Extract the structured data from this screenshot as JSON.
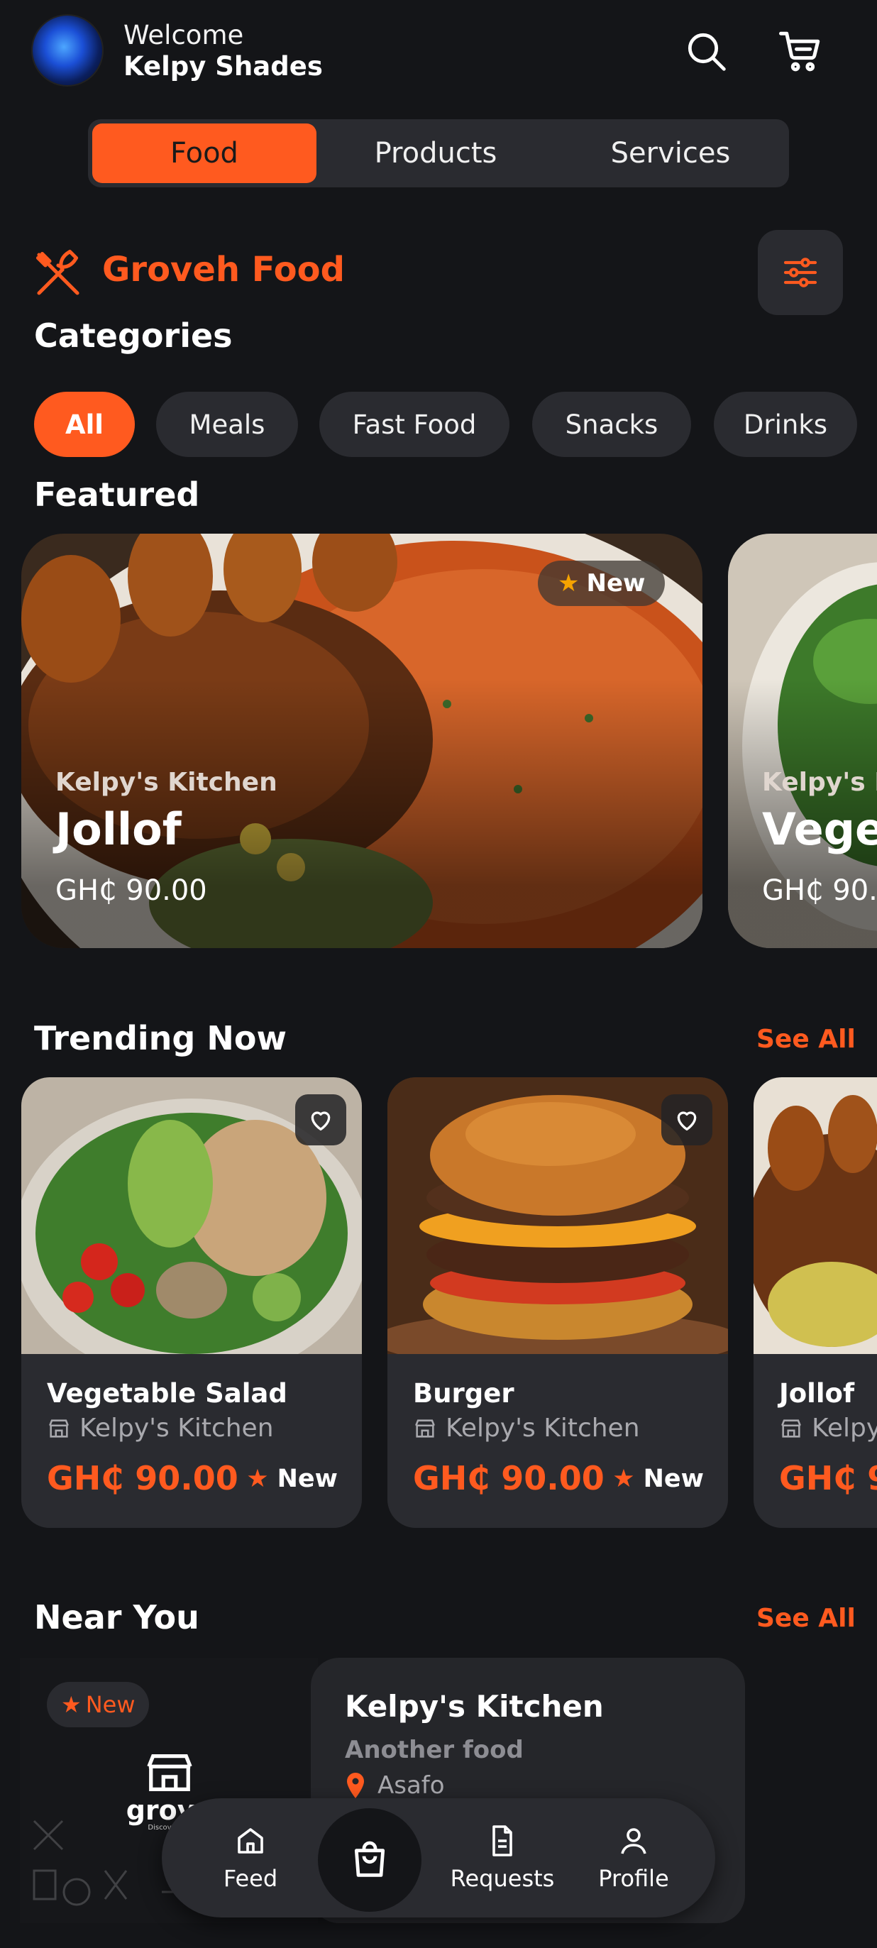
{
  "header": {
    "welcome": "Welcome",
    "username": "Kelpy Shades"
  },
  "tabs": [
    "Food",
    "Products",
    "Services"
  ],
  "brand": {
    "name": "Groveh Food"
  },
  "categories": {
    "title": "Categories",
    "items": [
      "All",
      "Meals",
      "Fast Food",
      "Snacks",
      "Drinks"
    ]
  },
  "featured": {
    "title": "Featured",
    "cards": [
      {
        "vendor": "Kelpy's Kitchen",
        "name": "Jollof",
        "price": "GH₵ 90.00",
        "badge": "New"
      },
      {
        "vendor": "Kelpy's K",
        "name": "Veget",
        "price": "GH₵ 90."
      }
    ]
  },
  "trending": {
    "title": "Trending Now",
    "see_all": "See All",
    "cards": [
      {
        "name": "Vegetable Salad",
        "vendor": "Kelpy's Kitchen",
        "price": "GH₵ 90.00",
        "badge": "New"
      },
      {
        "name": "Burger",
        "vendor": "Kelpy's Kitchen",
        "price": "GH₵ 90.00",
        "badge": "New"
      },
      {
        "name": "Jollof",
        "vendor": "Kelpy",
        "price": "GH₵ 9"
      }
    ]
  },
  "near": {
    "title": "Near You",
    "see_all": "See All",
    "badge": "New",
    "logo_text": "grove",
    "logo_tagline": "Discover, Of",
    "card": {
      "name": "Kelpy's Kitchen",
      "subtitle": "Another food",
      "location": "Asafo"
    }
  },
  "nav": {
    "feed": "Feed",
    "requests": "Requests",
    "profile": "Profile"
  },
  "colors": {
    "accent": "#ff5a1f",
    "background": "#141518",
    "surface": "#2a2b30"
  }
}
